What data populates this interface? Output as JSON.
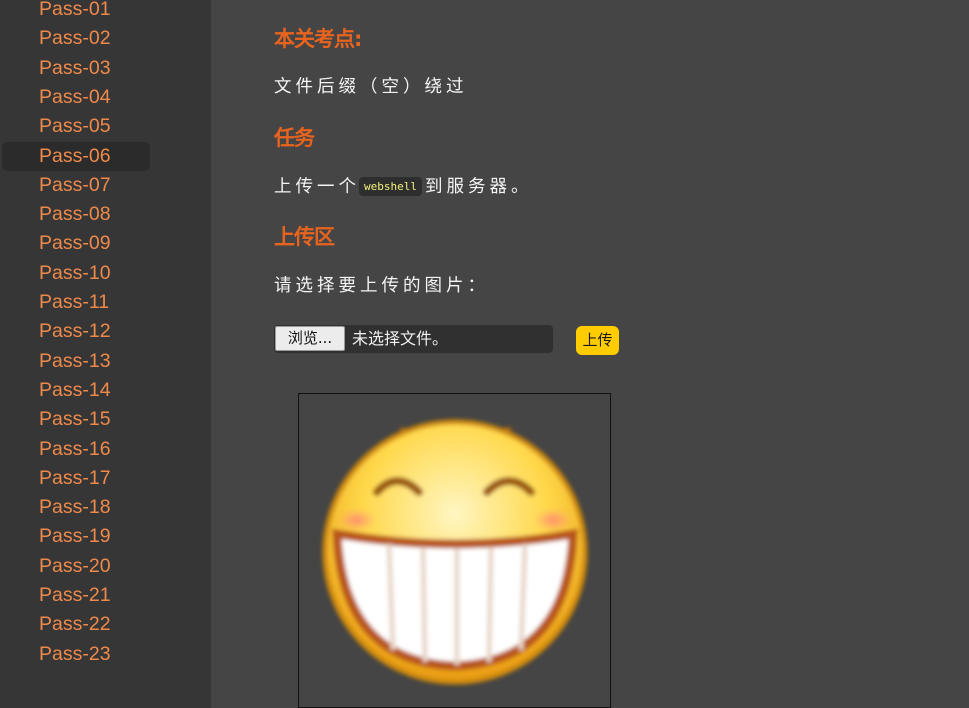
{
  "sidebar": {
    "items": [
      {
        "label": "Pass-01"
      },
      {
        "label": "Pass-02"
      },
      {
        "label": "Pass-03"
      },
      {
        "label": "Pass-04"
      },
      {
        "label": "Pass-05"
      },
      {
        "label": "Pass-06",
        "active": true
      },
      {
        "label": "Pass-07"
      },
      {
        "label": "Pass-08"
      },
      {
        "label": "Pass-09"
      },
      {
        "label": "Pass-10"
      },
      {
        "label": "Pass-11"
      },
      {
        "label": "Pass-12"
      },
      {
        "label": "Pass-13"
      },
      {
        "label": "Pass-14"
      },
      {
        "label": "Pass-15"
      },
      {
        "label": "Pass-16"
      },
      {
        "label": "Pass-17"
      },
      {
        "label": "Pass-18"
      },
      {
        "label": "Pass-19"
      },
      {
        "label": "Pass-20"
      },
      {
        "label": "Pass-21"
      },
      {
        "label": "Pass-22"
      },
      {
        "label": "Pass-23"
      }
    ]
  },
  "main": {
    "keypoint_heading": "本关考点:",
    "keypoint_text": "文件后缀（空）绕过",
    "task_heading": "任务",
    "task_prefix": "上传一个",
    "task_code": "webshell",
    "task_suffix": "到服务器。",
    "upload_heading": "上传区",
    "upload_prompt": "请选择要上传的图片：",
    "browse_label": "浏览...",
    "file_status": "未选择文件。",
    "upload_label": "上传",
    "preview_icon": "laughing-emoji-icon"
  },
  "colors": {
    "heading": "#e8641e",
    "nav_link": "#f08a4b",
    "upload_button": "#ffcc00",
    "code_text": "#f2f27a"
  }
}
